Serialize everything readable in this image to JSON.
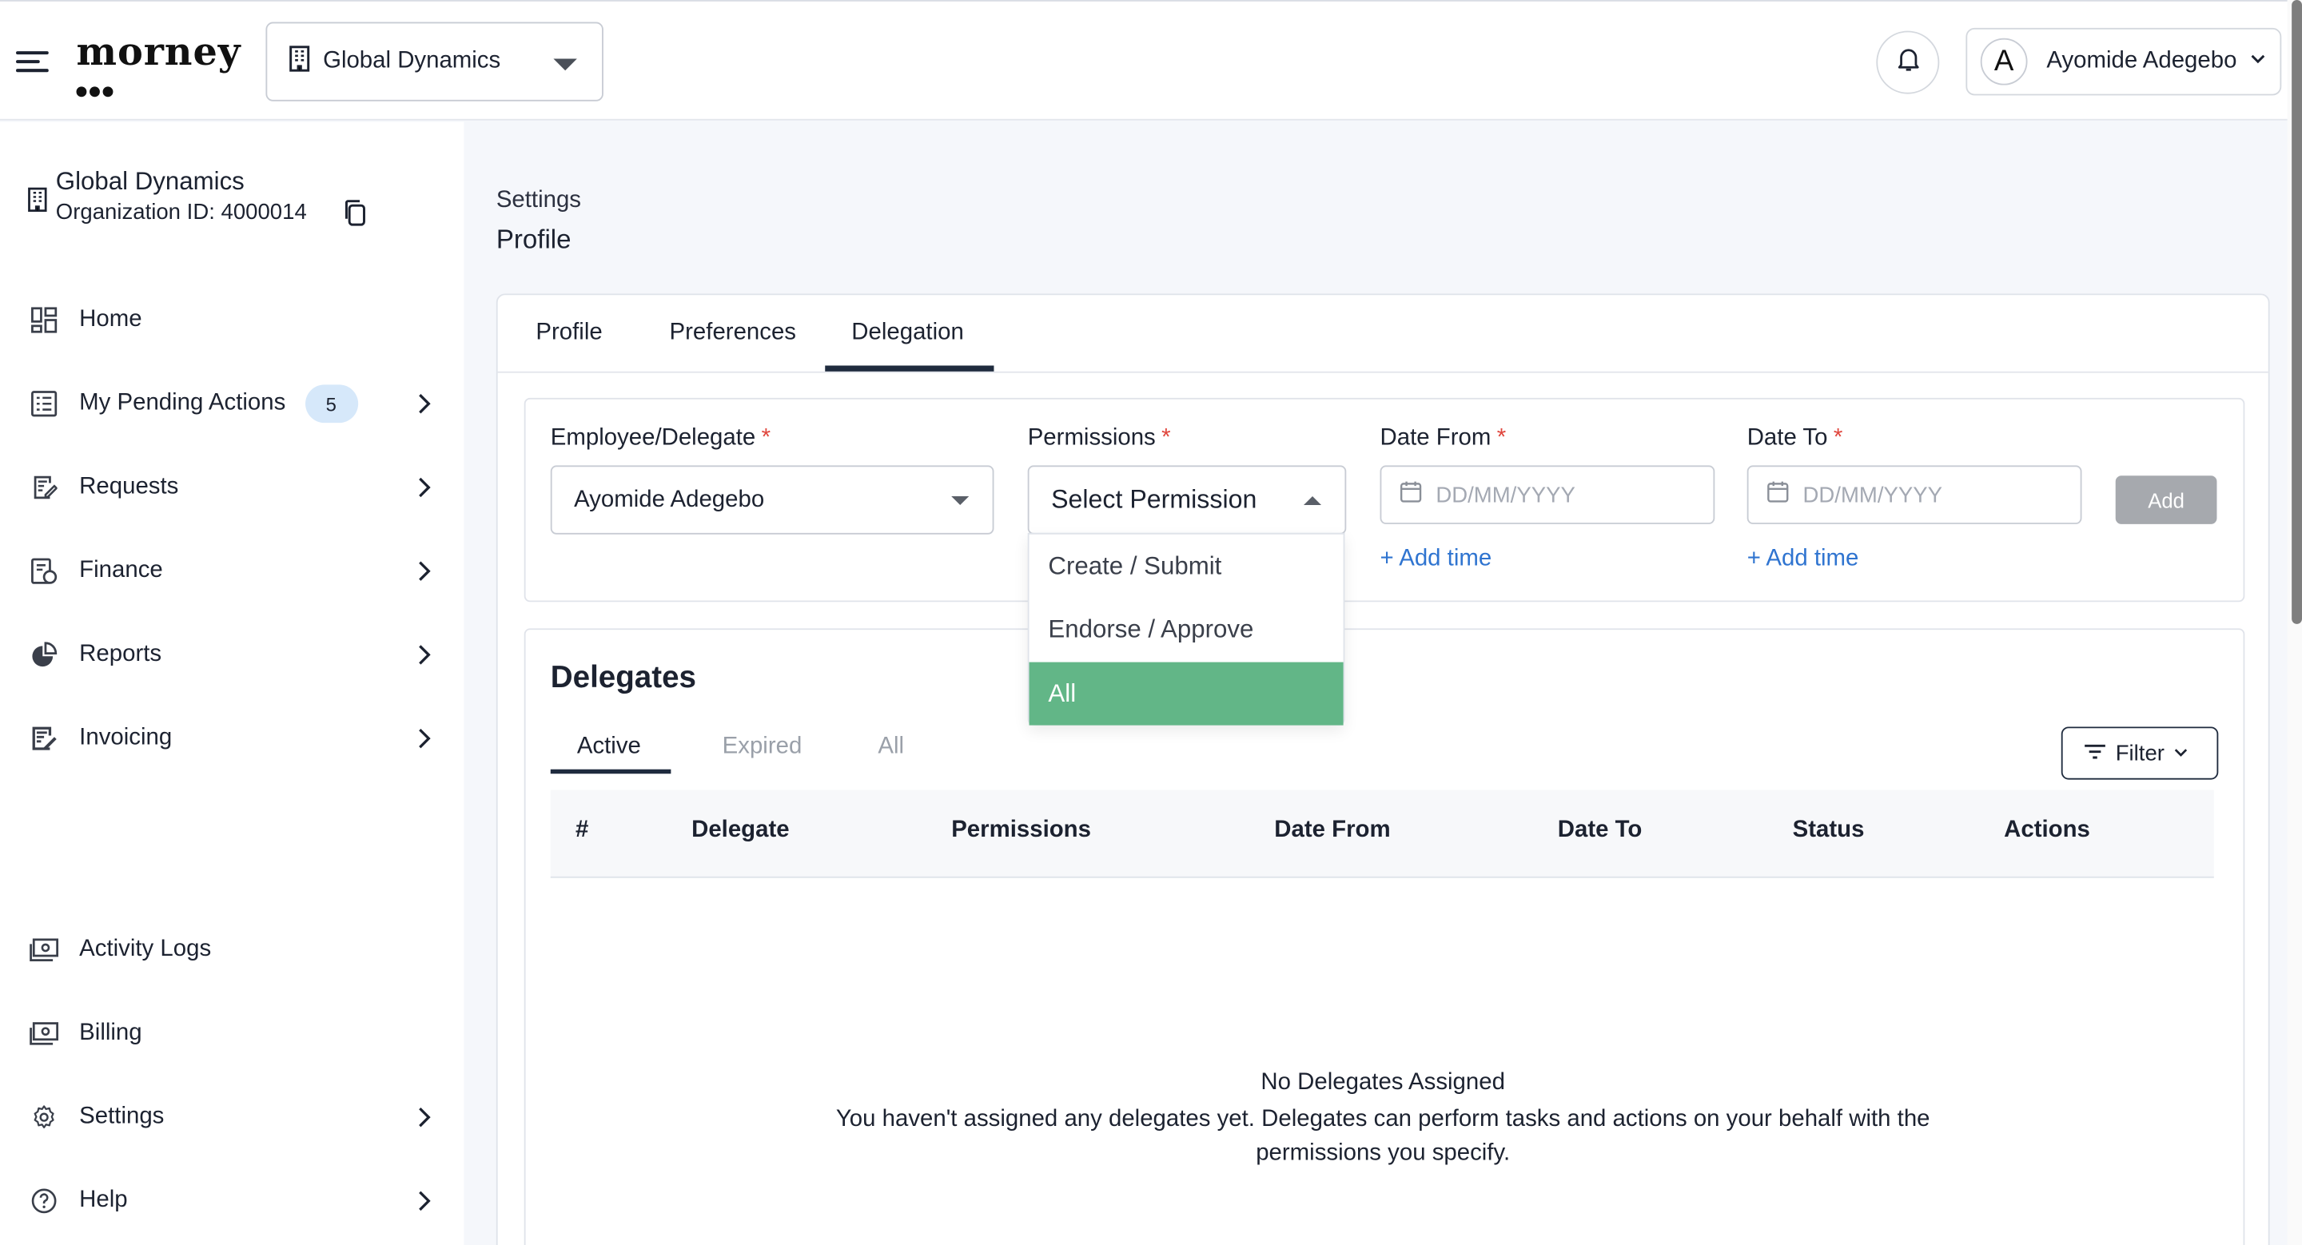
{
  "header": {
    "logo_text": "morney",
    "org_select": "Global Dynamics",
    "user_initial": "A",
    "user_name": "Ayomide Adegebo"
  },
  "sidebar": {
    "org_name": "Global Dynamics",
    "org_id": "Organization ID: 4000014",
    "items": [
      {
        "label": "Home",
        "icon": "home-grid-icon"
      },
      {
        "label": "My Pending Actions",
        "badge": "5",
        "icon": "list-icon"
      },
      {
        "label": "Requests",
        "icon": "request-icon"
      },
      {
        "label": "Finance",
        "icon": "finance-icon"
      },
      {
        "label": "Reports",
        "icon": "pie-chart-icon"
      },
      {
        "label": "Invoicing",
        "icon": "invoice-icon"
      },
      {
        "label": "Activity Logs",
        "icon": "activity-icon"
      },
      {
        "label": "Billing",
        "icon": "billing-icon"
      },
      {
        "label": "Settings",
        "icon": "gear-icon"
      },
      {
        "label": "Help",
        "icon": "help-icon"
      }
    ]
  },
  "main": {
    "breadcrumb": "Settings",
    "title": "Profile",
    "tabs": [
      "Profile",
      "Preferences",
      "Delegation"
    ],
    "active_tab": "Delegation",
    "form": {
      "employee_label": "Employee/Delegate",
      "employee_value": "Ayomide Adegebo",
      "permissions_label": "Permissions",
      "permissions_value": "Select Permission",
      "date_from_label": "Date From",
      "date_to_label": "Date To",
      "date_placeholder": "DD/MM/YYYY",
      "add_time": "+ Add time",
      "add_button": "Add",
      "required_mark": "*"
    },
    "permission_options": [
      "Create / Submit",
      "Endorse / Approve",
      "All"
    ],
    "highlighted_option": "All",
    "delegates": {
      "title": "Delegates",
      "subtabs": [
        "Active",
        "Expired",
        "All"
      ],
      "filter_label": "Filter",
      "columns": [
        "#",
        "Delegate",
        "Permissions",
        "Date From",
        "Date To",
        "Status",
        "Actions"
      ],
      "empty_title": "No Delegates Assigned",
      "empty_desc": "You haven't assigned any delegates yet. Delegates can perform tasks and actions on your behalf with the permissions you specify."
    }
  },
  "colors": {
    "accent_green": "#62b687",
    "link_blue": "#2f74d0",
    "required_red": "#e0473e",
    "badge_bg": "#d6e8fa"
  }
}
